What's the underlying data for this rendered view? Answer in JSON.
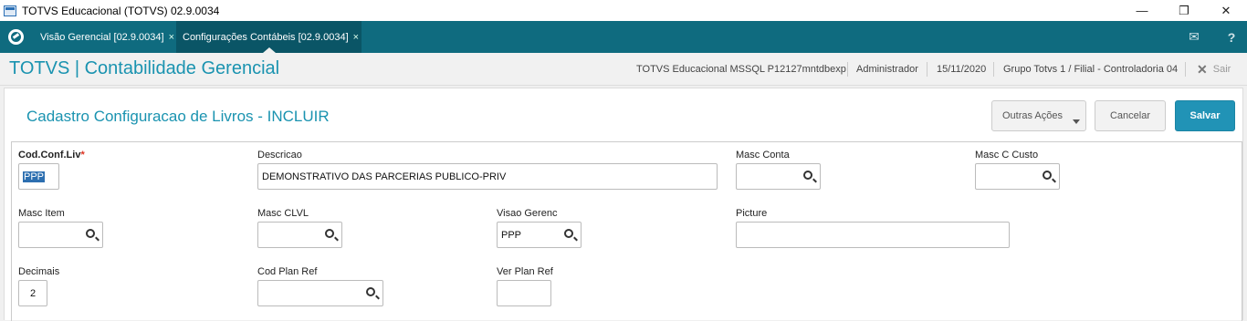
{
  "window": {
    "title": "TOTVS Educacional (TOTVS) 02.9.0034",
    "controls": {
      "minimize": "—",
      "restore": "❐",
      "close": "✕"
    }
  },
  "tabs": [
    {
      "label": "Visão Gerencial [02.9.0034]",
      "close": "×",
      "active": false
    },
    {
      "label": "Configurações Contábeis [02.9.0034]",
      "close": "×",
      "active": true
    }
  ],
  "tabbar_icons": {
    "mail": "✉",
    "help": "?"
  },
  "header": {
    "module": "TOTVS | Contabilidade Gerencial",
    "environment": "TOTVS Educacional MSSQL P12127mntdbexp",
    "user": "Administrador",
    "date": "15/11/2020",
    "company": "Grupo Totvs 1 / Filial - Controladoria 04",
    "exit_icon": "✕",
    "exit_label": "Sair"
  },
  "page": {
    "title": "Cadastro Configuracao de Livros - INCLUIR",
    "buttons": {
      "more_actions": "Outras Ações",
      "cancel": "Cancelar",
      "save": "Salvar"
    }
  },
  "form": {
    "cod_conf_liv": {
      "label": "Cod.Conf.Liv",
      "required_mark": "*",
      "value": "PPP"
    },
    "descricao": {
      "label": "Descricao",
      "value": "DEMONSTRATIVO DAS PARCERIAS PUBLICO-PRIV"
    },
    "masc_conta": {
      "label": "Masc Conta",
      "value": ""
    },
    "masc_c_custo": {
      "label": "Masc C Custo",
      "value": ""
    },
    "masc_item": {
      "label": "Masc Item",
      "value": ""
    },
    "masc_clvl": {
      "label": "Masc CLVL",
      "value": ""
    },
    "visao_gerenc": {
      "label": "Visao Gerenc",
      "value": "PPP"
    },
    "picture": {
      "label": "Picture",
      "value": ""
    },
    "decimais": {
      "label": "Decimais",
      "value": "2"
    },
    "cod_plan_ref": {
      "label": "Cod Plan Ref",
      "value": ""
    },
    "ver_plan_ref": {
      "label": "Ver Plan Ref",
      "value": ""
    }
  },
  "colors": {
    "accent": "#1a93b0",
    "tabbar": "#0f6b7f",
    "primary_button": "#2193b6",
    "required": "#d32"
  }
}
